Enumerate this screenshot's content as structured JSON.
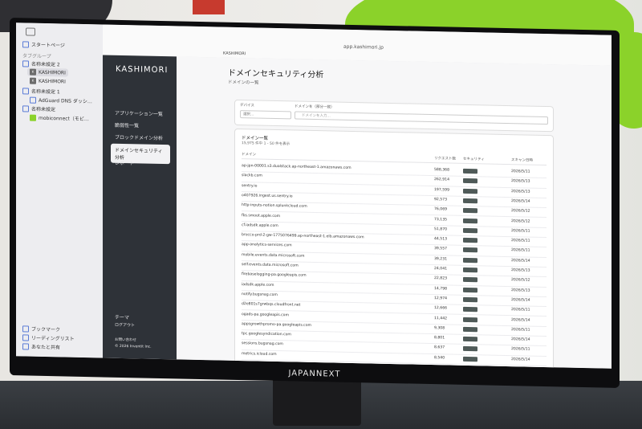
{
  "safari": {
    "start_page": "スタートページ",
    "tab_group_header": "タブグループ",
    "groups": [
      {
        "label": "名称未設定 2"
      },
      {
        "label": "KASHIMORI"
      },
      {
        "label": "KASHIMORI"
      },
      {
        "label": "名称未設定 1"
      },
      {
        "label": "AdGuard DNS ダッシ…"
      },
      {
        "label": "名称未設定"
      },
      {
        "label": "mobiconnect（モビ…"
      }
    ],
    "footer": [
      "ブックマーク",
      "リーディングリスト",
      "あなたと共有"
    ],
    "url": "app.kashimori.jp"
  },
  "app": {
    "logo": "KASHIMORI",
    "nav": [
      "アプリケーション一覧",
      "脆弱性一覧",
      "ブロックドメイン分析",
      "ドメインセキュリティ分析",
      "レポート"
    ],
    "theme_label": "テーマ",
    "logout": "ログアウト",
    "contact": "お問い合わせ",
    "copyright": "© 2026 Inventit Inc."
  },
  "main": {
    "title": "ドメインセキュリティ分析",
    "subtitle": "ドメインの一覧",
    "filter": {
      "device_label": "デバイス",
      "device_select": "選択...",
      "domain_label": "ドメインを（部分一致）",
      "domain_placeholder": "ドメインを入力..."
    },
    "list_title": "ドメイン一覧",
    "count": "15,975 件中 1 - 50 件を表示",
    "columns": [
      "ドメイン",
      "リクエスト数",
      "セキュリティ",
      "スキャン日時"
    ],
    "rows": [
      {
        "domain": "ap-jpn-00001.s3.dualstack.ap-northeast-1.amazonaws.com",
        "req": "588,368",
        "date": "2026/5/11"
      },
      {
        "domain": "slackb.com",
        "req": "262,914",
        "date": "2026/5/13"
      },
      {
        "domain": "sentry.io",
        "req": "197,599",
        "date": "2026/5/13"
      },
      {
        "domain": "o407926.ingest.us.sentry.io",
        "req": "92,573",
        "date": "2026/5/14"
      },
      {
        "domain": "http-inputs-notion.splunkcloud.com",
        "req": "76,069",
        "date": "2026/5/12"
      },
      {
        "domain": "fbs.smoot.apple.com",
        "req": "73,135",
        "date": "2026/5/12"
      },
      {
        "domain": "cf.iadsdk.apple.com",
        "req": "51,870",
        "date": "2026/5/11"
      },
      {
        "domain": "brocco-prd-2-gw-1775076499.ap-northeast-1.elb.amazonaws.com",
        "req": "44,513",
        "date": "2026/5/11"
      },
      {
        "domain": "app-analytics-services.com",
        "req": "39,557",
        "date": "2026/5/11"
      },
      {
        "domain": "mobile.events.data.microsoft.com",
        "req": "39,231",
        "date": "2026/5/14"
      },
      {
        "domain": "self.events.data.microsoft.com",
        "req": "24,041",
        "date": "2026/5/13"
      },
      {
        "domain": "firebaselogging-pa.googleapis.com",
        "req": "22,823",
        "date": "2026/5/12"
      },
      {
        "domain": "iadsdk.apple.com",
        "req": "14,798",
        "date": "2026/5/13"
      },
      {
        "domain": "notify.bugsnag.com",
        "req": "12,974",
        "date": "2026/5/14"
      },
      {
        "domain": "d2e801s7grwbqs.cloudfront.net",
        "req": "12,666",
        "date": "2026/5/11"
      },
      {
        "domain": "ogads-pa.googleapis.com",
        "req": "11,442",
        "date": "2026/5/14"
      },
      {
        "domain": "appsgrowthpromo-pa.googleapis.com",
        "req": "9,308",
        "date": "2026/5/11"
      },
      {
        "domain": "tpc.googlesyndication.com",
        "req": "8,801",
        "date": "2026/5/14"
      },
      {
        "domain": "sessions.bugsnag.com",
        "req": "8,637",
        "date": "2026/5/11"
      },
      {
        "domain": "metrics.icloud.com",
        "req": "8,540",
        "date": "2026/5/14"
      },
      {
        "domain": "browser-intake-datadoghq.com",
        "req": "7,881",
        "date": "2026/5/11"
      }
    ]
  },
  "monitor_brand": "JAPANNEXT",
  "colors": {
    "sidebar": "#2e3238",
    "accent_green": "#8bd22a",
    "bar": "#4f5a58"
  }
}
